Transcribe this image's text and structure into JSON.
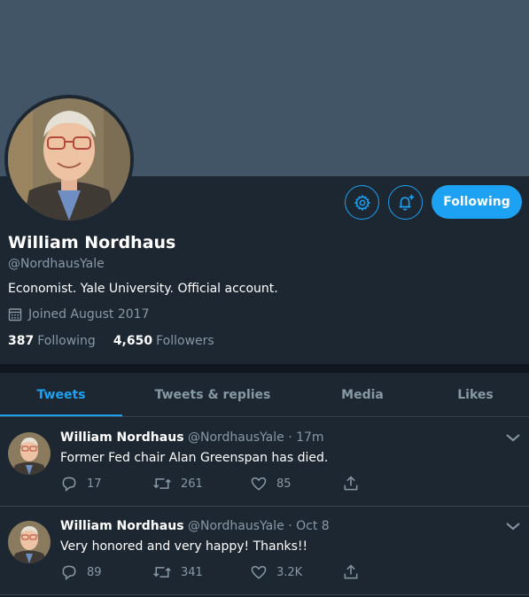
{
  "profile": {
    "name": "William Nordhaus",
    "handle": "@NordhausYale",
    "bio": "Economist. Yale University. Official account.",
    "joined": "Joined August 2017",
    "following_count": "387",
    "following_label": "Following",
    "followers_count": "4,650",
    "followers_label": "Followers",
    "follow_button_label": "Following",
    "settings_icon": "gear-icon",
    "notify_icon": "bell-plus-icon"
  },
  "tabs": [
    {
      "label": "Tweets",
      "active": true
    },
    {
      "label": "Tweets & replies",
      "active": false
    },
    {
      "label": "Media",
      "active": false
    },
    {
      "label": "Likes",
      "active": false
    }
  ],
  "tweets": [
    {
      "author": "William Nordhaus",
      "handle": "@NordhausYale",
      "time": "· 17m",
      "text": "Former Fed chair Alan Greenspan has died.",
      "replies": "17",
      "retweets": "261",
      "likes": "85"
    },
    {
      "author": "William Nordhaus",
      "handle": "@NordhausYale",
      "time": "· Oct 8",
      "text": "Very honored and very happy! Thanks!!",
      "replies": "89",
      "retweets": "341",
      "likes": "3.2K"
    }
  ],
  "colors": {
    "accent": "#1da1f2",
    "background": "#15202b",
    "card": "#1c2732",
    "banner": "#425566",
    "muted_text": "#8899a6"
  }
}
